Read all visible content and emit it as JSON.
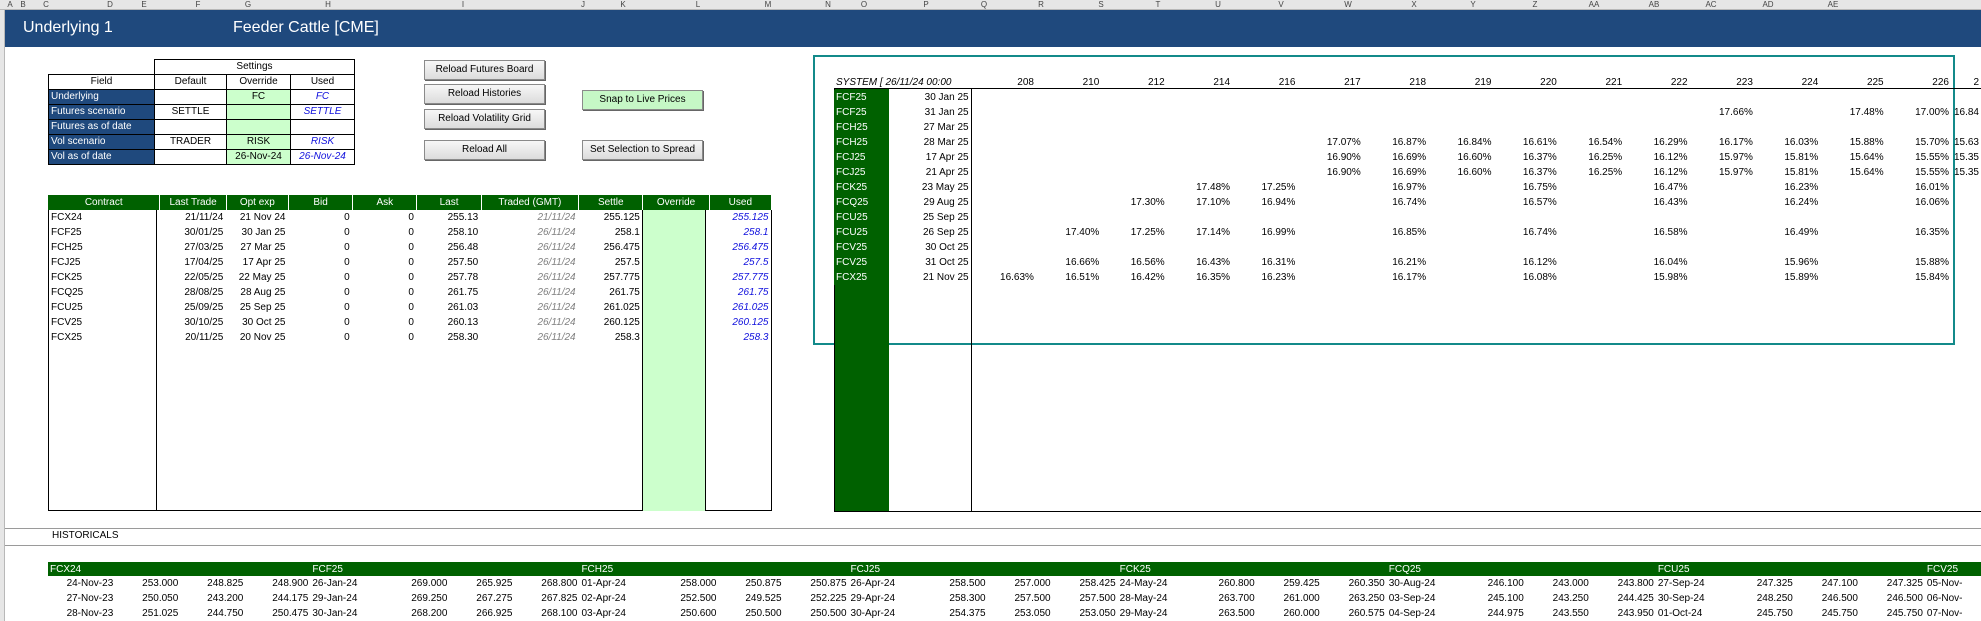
{
  "column_letters": [
    "A",
    "B",
    "C",
    "D",
    "E",
    "F",
    "G",
    "H",
    "I",
    "J",
    "K",
    "L",
    "M",
    "N",
    "O",
    "P",
    "Q",
    "R",
    "S",
    "T",
    "U",
    "V",
    "W",
    "X",
    "Y",
    "Z",
    "AA",
    "AB",
    "AC",
    "AD",
    "AE"
  ],
  "title": {
    "label": "Underlying 1",
    "product": "Feeder Cattle  [CME]"
  },
  "settings": {
    "header": "Settings",
    "col_headers": [
      "Field",
      "Default",
      "Override",
      "Used"
    ],
    "rows": [
      {
        "field": "Underlying",
        "default": "",
        "override": "FC",
        "used": "FC"
      },
      {
        "field": "Futures scenario",
        "default": "SETTLE",
        "override": "",
        "used": "SETTLE"
      },
      {
        "field": "Futures as of date",
        "default": "",
        "override": "",
        "used": ""
      },
      {
        "field": "Vol scenario",
        "default": "TRADER",
        "override": "RISK",
        "used": "RISK"
      },
      {
        "field": "Vol as of date",
        "default": "",
        "override": "26-Nov-24",
        "used": "26-Nov-24"
      }
    ]
  },
  "buttons": {
    "reload_futures": "Reload Futures Board",
    "reload_histories": "Reload Histories",
    "reload_vol_grid": "Reload Volatility Grid",
    "reload_all": "Reload All",
    "snap_live": "Snap to Live Prices",
    "set_spread": "Set Selection to Spread"
  },
  "contracts": {
    "headers": [
      "Contract",
      "Last Trade",
      "Opt exp",
      "Bid",
      "Ask",
      "Last",
      "Traded (GMT)",
      "Settle",
      "Override",
      "Used"
    ],
    "rows": [
      [
        "FCX24",
        "21/11/24",
        "21 Nov 24",
        "0",
        "0",
        "255.13",
        "21/11/24",
        "255.125",
        "",
        "255.125"
      ],
      [
        "FCF25",
        "30/01/25",
        "30 Jan 25",
        "0",
        "0",
        "258.10",
        "26/11/24",
        "258.1",
        "",
        "258.1"
      ],
      [
        "FCH25",
        "27/03/25",
        "27 Mar 25",
        "0",
        "0",
        "256.48",
        "26/11/24",
        "256.475",
        "",
        "256.475"
      ],
      [
        "FCJ25",
        "17/04/25",
        "17 Apr 25",
        "0",
        "0",
        "257.50",
        "26/11/24",
        "257.5",
        "",
        "257.5"
      ],
      [
        "FCK25",
        "22/05/25",
        "22 May 25",
        "0",
        "0",
        "257.78",
        "26/11/24",
        "257.775",
        "",
        "257.775"
      ],
      [
        "FCQ25",
        "28/08/25",
        "28 Aug 25",
        "0",
        "0",
        "261.75",
        "26/11/24",
        "261.75",
        "",
        "261.75"
      ],
      [
        "FCU25",
        "25/09/25",
        "25 Sep 25",
        "0",
        "0",
        "261.03",
        "26/11/24",
        "261.025",
        "",
        "261.025"
      ],
      [
        "FCV25",
        "30/10/25",
        "30 Oct 25",
        "0",
        "0",
        "260.13",
        "26/11/24",
        "260.125",
        "",
        "260.125"
      ],
      [
        "FCX25",
        "20/11/25",
        "20 Nov 25",
        "0",
        "0",
        "258.30",
        "26/11/24",
        "258.3",
        "",
        "258.3"
      ]
    ]
  },
  "volgrid": {
    "corner": "SYSTEM [ 26/11/24 00:00",
    "strikes": [
      "208",
      "210",
      "212",
      "214",
      "216",
      "217",
      "218",
      "219",
      "220",
      "221",
      "222",
      "223",
      "224",
      "225",
      "226",
      "2"
    ],
    "rows": [
      {
        "c": "FCF25",
        "d": "30 Jan 25",
        "v": [
          "",
          "",
          "",
          "",
          "",
          "",
          "",
          "",
          "",
          "",
          "",
          "",
          "",
          "",
          "",
          ""
        ]
      },
      {
        "c": "FCF25",
        "d": "31 Jan 25",
        "v": [
          "",
          "",
          "",
          "",
          "",
          "",
          "",
          "",
          "",
          "",
          "",
          "17.66%",
          "",
          "17.48%",
          "17.00%",
          "16.84"
        ]
      },
      {
        "c": "FCH25",
        "d": "27 Mar 25",
        "v": [
          "",
          "",
          "",
          "",
          "",
          "",
          "",
          "",
          "",
          "",
          "",
          "",
          "",
          "",
          "",
          ""
        ]
      },
      {
        "c": "FCH25",
        "d": "28 Mar 25",
        "v": [
          "",
          "",
          "",
          "",
          "",
          "17.07%",
          "16.87%",
          "16.84%",
          "16.61%",
          "16.54%",
          "16.29%",
          "16.17%",
          "16.03%",
          "15.88%",
          "15.70%",
          "15.63"
        ]
      },
      {
        "c": "FCJ25",
        "d": "17 Apr 25",
        "v": [
          "",
          "",
          "",
          "",
          "",
          "16.90%",
          "16.69%",
          "16.60%",
          "16.37%",
          "16.25%",
          "16.12%",
          "15.97%",
          "15.81%",
          "15.64%",
          "15.55%",
          "15.35"
        ]
      },
      {
        "c": "FCJ25",
        "d": "21 Apr 25",
        "v": [
          "",
          "",
          "",
          "",
          "",
          "16.90%",
          "16.69%",
          "16.60%",
          "16.37%",
          "16.25%",
          "16.12%",
          "15.97%",
          "15.81%",
          "15.64%",
          "15.55%",
          "15.35"
        ]
      },
      {
        "c": "FCK25",
        "d": "23 May 25",
        "v": [
          "",
          "",
          "",
          "17.48%",
          "17.25%",
          "",
          "16.97%",
          "",
          "16.75%",
          "",
          "16.47%",
          "",
          "16.23%",
          "",
          "16.01%",
          ""
        ]
      },
      {
        "c": "FCQ25",
        "d": "29 Aug 25",
        "v": [
          "",
          "",
          "17.30%",
          "17.10%",
          "16.94%",
          "",
          "16.74%",
          "",
          "16.57%",
          "",
          "16.43%",
          "",
          "16.24%",
          "",
          "16.06%",
          ""
        ]
      },
      {
        "c": "FCU25",
        "d": "25 Sep 25",
        "v": [
          "",
          "",
          "",
          "",
          "",
          "",
          "",
          "",
          "",
          "",
          "",
          "",
          "",
          "",
          "",
          ""
        ]
      },
      {
        "c": "FCU25",
        "d": "26 Sep 25",
        "v": [
          "",
          "17.40%",
          "17.25%",
          "17.14%",
          "16.99%",
          "",
          "16.85%",
          "",
          "16.74%",
          "",
          "16.58%",
          "",
          "16.49%",
          "",
          "16.35%",
          ""
        ]
      },
      {
        "c": "FCV25",
        "d": "30 Oct 25",
        "v": [
          "",
          "",
          "",
          "",
          "",
          "",
          "",
          "",
          "",
          "",
          "",
          "",
          "",
          "",
          "",
          ""
        ]
      },
      {
        "c": "FCV25",
        "d": "31 Oct 25",
        "v": [
          "",
          "16.66%",
          "16.56%",
          "16.43%",
          "16.31%",
          "",
          "16.21%",
          "",
          "16.12%",
          "",
          "16.04%",
          "",
          "15.96%",
          "",
          "15.88%",
          ""
        ]
      },
      {
        "c": "FCX25",
        "d": "21 Nov 25",
        "v": [
          "16.63%",
          "16.51%",
          "16.42%",
          "16.35%",
          "16.23%",
          "",
          "16.17%",
          "",
          "16.08%",
          "",
          "15.98%",
          "",
          "15.89%",
          "",
          "15.84%",
          ""
        ]
      }
    ]
  },
  "historicals": {
    "label": "HISTORICALS",
    "contracts": [
      "FCX24",
      "FCF25",
      "FCH25",
      "FCJ25",
      "FCK25",
      "FCQ25",
      "FCU25",
      "FCV25"
    ],
    "rows": [
      [
        "24-Nov-23",
        "253.000",
        "248.825",
        "248.900",
        "26-Jan-24",
        "269.000",
        "265.925",
        "268.800",
        "01-Apr-24",
        "258.000",
        "250.875",
        "250.875",
        "26-Apr-24",
        "258.500",
        "257.000",
        "258.425",
        "24-May-24",
        "260.800",
        "259.425",
        "260.350",
        "30-Aug-24",
        "246.100",
        "243.000",
        "243.800",
        "27-Sep-24",
        "247.325",
        "247.100",
        "247.325",
        "05-Nov-"
      ],
      [
        "27-Nov-23",
        "250.050",
        "243.200",
        "244.175",
        "29-Jan-24",
        "269.250",
        "267.275",
        "267.825",
        "02-Apr-24",
        "252.500",
        "249.525",
        "252.225",
        "29-Apr-24",
        "258.300",
        "257.500",
        "257.500",
        "28-May-24",
        "263.700",
        "261.000",
        "263.250",
        "03-Sep-24",
        "245.100",
        "243.250",
        "244.425",
        "30-Sep-24",
        "248.250",
        "246.500",
        "246.500",
        "06-Nov-"
      ],
      [
        "28-Nov-23",
        "251.025",
        "244.750",
        "250.475",
        "30-Jan-24",
        "268.200",
        "266.925",
        "268.100",
        "03-Apr-24",
        "250.600",
        "250.500",
        "250.500",
        "30-Apr-24",
        "254.375",
        "253.050",
        "253.050",
        "29-May-24",
        "263.500",
        "260.000",
        "260.575",
        "04-Sep-24",
        "244.975",
        "243.550",
        "243.950",
        "01-Oct-24",
        "245.750",
        "245.750",
        "245.750",
        "07-Nov-"
      ]
    ]
  }
}
